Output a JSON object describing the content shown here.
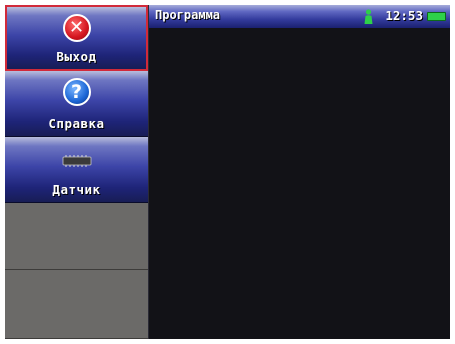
{
  "sidebar": {
    "items": [
      {
        "label": "Выход",
        "icon": "close-icon",
        "selected": true
      },
      {
        "label": "Справка",
        "icon": "help-icon",
        "selected": false
      },
      {
        "label": "Датчик",
        "icon": "sensor-chip-icon",
        "selected": false
      }
    ],
    "empty_slots": 2
  },
  "header": {
    "title": "Программа",
    "time": "12:53",
    "status_icons": [
      "person-icon",
      "battery-icon"
    ]
  },
  "colors": {
    "button_blue": "#3d45a8",
    "selected_border": "#d12a3a",
    "close_red": "#d4151f",
    "help_blue": "#1c66d6",
    "battery_green": "#2ed04a",
    "content_bg": "#121217",
    "empty_slot_gray": "#6b6a68"
  }
}
